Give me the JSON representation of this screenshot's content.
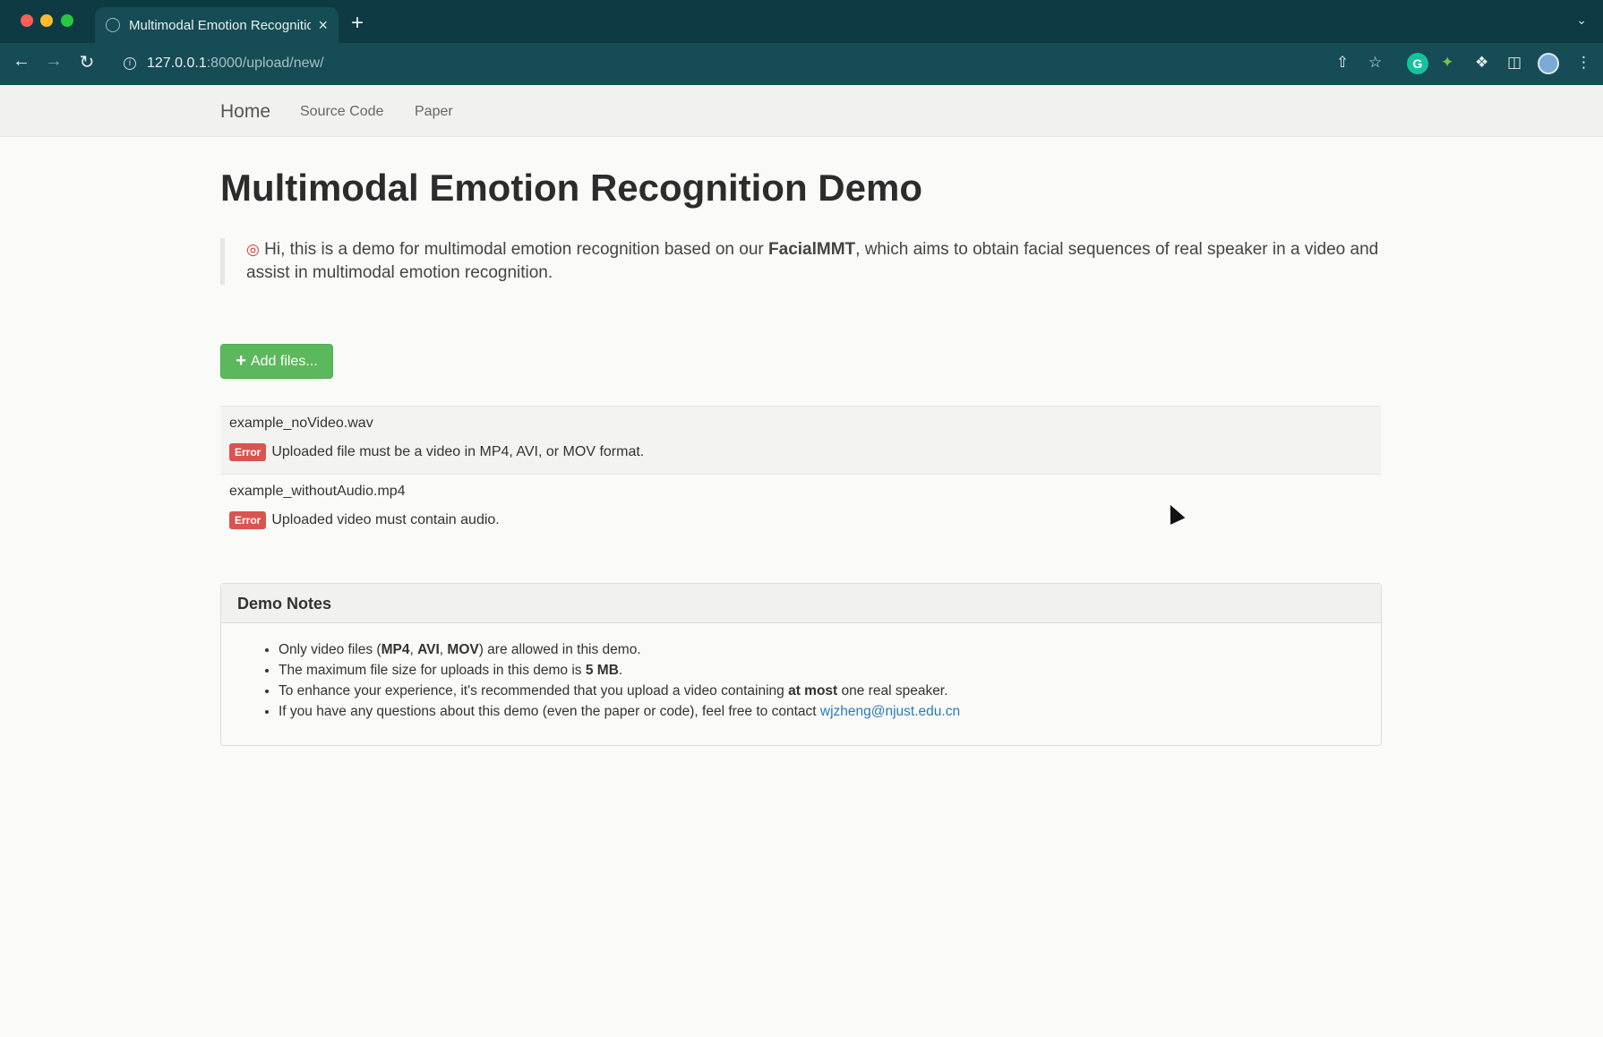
{
  "browser": {
    "tab_title": "Multimodal Emotion Recognitio",
    "new_tab": "+",
    "tab_close": "×",
    "url_host": "127.0.0.1",
    "url_rest": ":8000/upload/new/"
  },
  "navbar": {
    "brand": "Home",
    "links": [
      "Source Code",
      "Paper"
    ]
  },
  "page": {
    "title": "Multimodal Emotion Recognition Demo",
    "intro_pre": "Hi, this is a demo for multimodal emotion recognition based on our ",
    "intro_bold": "FacialMMT",
    "intro_post": ", which aims to obtain facial sequences of real speaker in a video and assist in multimodal emotion recognition."
  },
  "upload": {
    "add_button": "Add files...",
    "files": [
      {
        "name": "example_noVideo.wav",
        "badge": "Error",
        "message": "Uploaded file must be a video in MP4, AVI, or MOV format."
      },
      {
        "name": "example_withoutAudio.mp4",
        "badge": "Error",
        "message": "Uploaded video must contain audio."
      }
    ]
  },
  "notes": {
    "heading": "Demo Notes",
    "n1_a": "Only video files (",
    "n1_b1": "MP4",
    "n1_sep1": ", ",
    "n1_b2": "AVI",
    "n1_sep2": ", ",
    "n1_b3": "MOV",
    "n1_c": ") are allowed in this demo.",
    "n2_a": "The maximum file size for uploads in this demo is ",
    "n2_b": "5 MB",
    "n2_c": ".",
    "n3_a": "To enhance your experience, it's recommended that you upload a video containing ",
    "n3_b": "at most",
    "n3_c": " one real speaker.",
    "n4_a": "If you have any questions about this demo (even the paper or code), feel free to contact ",
    "n4_link": "wjzheng@njust.edu.cn"
  },
  "colors": {
    "success": "#5cb85c",
    "danger": "#d9534f",
    "link": "#2a7ab8",
    "chrome": "#0e3b43"
  }
}
